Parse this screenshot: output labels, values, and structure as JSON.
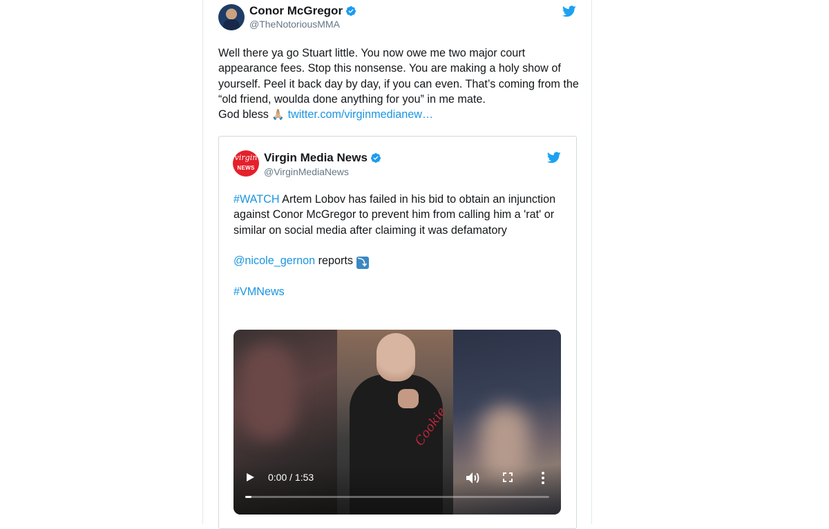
{
  "tweet": {
    "author_name": "Conor McGregor",
    "author_handle": "@TheNotoriousMMA",
    "text": "Well there ya go Stuart little. You now owe me two major court appearance fees. Stop this nonsense. You are making a holy show of yourself. Peel it back day by day, if you can even. That’s coming from the “old friend, woulda done anything for you” in me mate.",
    "closing": "God bless",
    "closing_emoji": "🙏🏼",
    "link": "twitter.com/virginmedianew…"
  },
  "quote": {
    "avatar_top": "virgin",
    "avatar_label": "NEWS",
    "author_name": "Virgin Media News",
    "author_handle": "@VirginMediaNews",
    "hashtag_watch": "#WATCH",
    "text": " Artem Lobov has failed in his bid to obtain an injunction against Conor McGregor to prevent him from calling him a 'rat' or similar on social media after claiming it was defamatory",
    "mention": "@nicole_gernon",
    "reports": " reports ",
    "hashtag_vmnews": "#VMNews",
    "video": {
      "time": "0:00 / 1:53",
      "progress": 0.02,
      "script_text": "Cookie"
    }
  },
  "colors": {
    "link": "#1b95e0",
    "verified": "#1d9bf0",
    "twitter_bird": "#1da1f2",
    "virgin_red": "#e4202b"
  },
  "icons": [
    "verified-badge-icon",
    "twitter-bird-icon",
    "play-icon",
    "volume-icon",
    "fullscreen-icon",
    "more-options-icon",
    "down-arrow-emoji-icon"
  ]
}
